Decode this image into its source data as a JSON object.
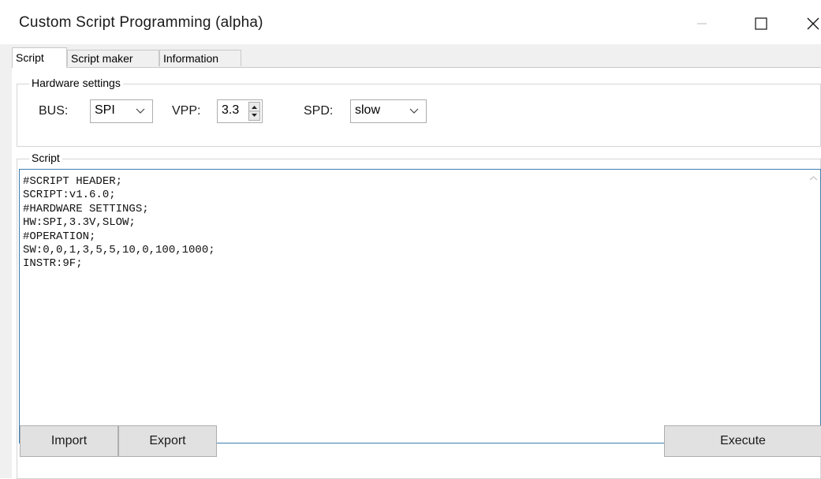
{
  "window": {
    "title": "Custom Script Programming (alpha)",
    "controls": [
      "minimize-icon",
      "maximize-icon",
      "close-icon"
    ]
  },
  "tabs": [
    {
      "label": "Script",
      "active": true
    },
    {
      "label": "Script maker",
      "active": false
    },
    {
      "label": "Information",
      "active": false
    }
  ],
  "hardware": {
    "legend": "Hardware settings",
    "bus_label": "BUS:",
    "bus_value": "SPI",
    "vpp_label": "VPP:",
    "vpp_value": "3.3",
    "spd_label": "SPD:",
    "spd_value": "slow"
  },
  "script": {
    "legend": "Script",
    "lines": [
      "#SCRIPT HEADER;",
      "SCRIPT:v1.6.0;",
      "#HARDWARE SETTINGS;",
      "HW:SPI,3.3V,SLOW;",
      "#OPERATION;",
      "SW:0,0,1,3,5,5,10,0,100,1000;",
      "INSTR:9F;"
    ]
  },
  "buttons": {
    "import": "Import",
    "export": "Export",
    "execute": "Execute"
  },
  "colors": {
    "editor_border": "#3c7fb1",
    "window_bg": "#f0f0f0",
    "button_bg": "#e1e1e1"
  }
}
